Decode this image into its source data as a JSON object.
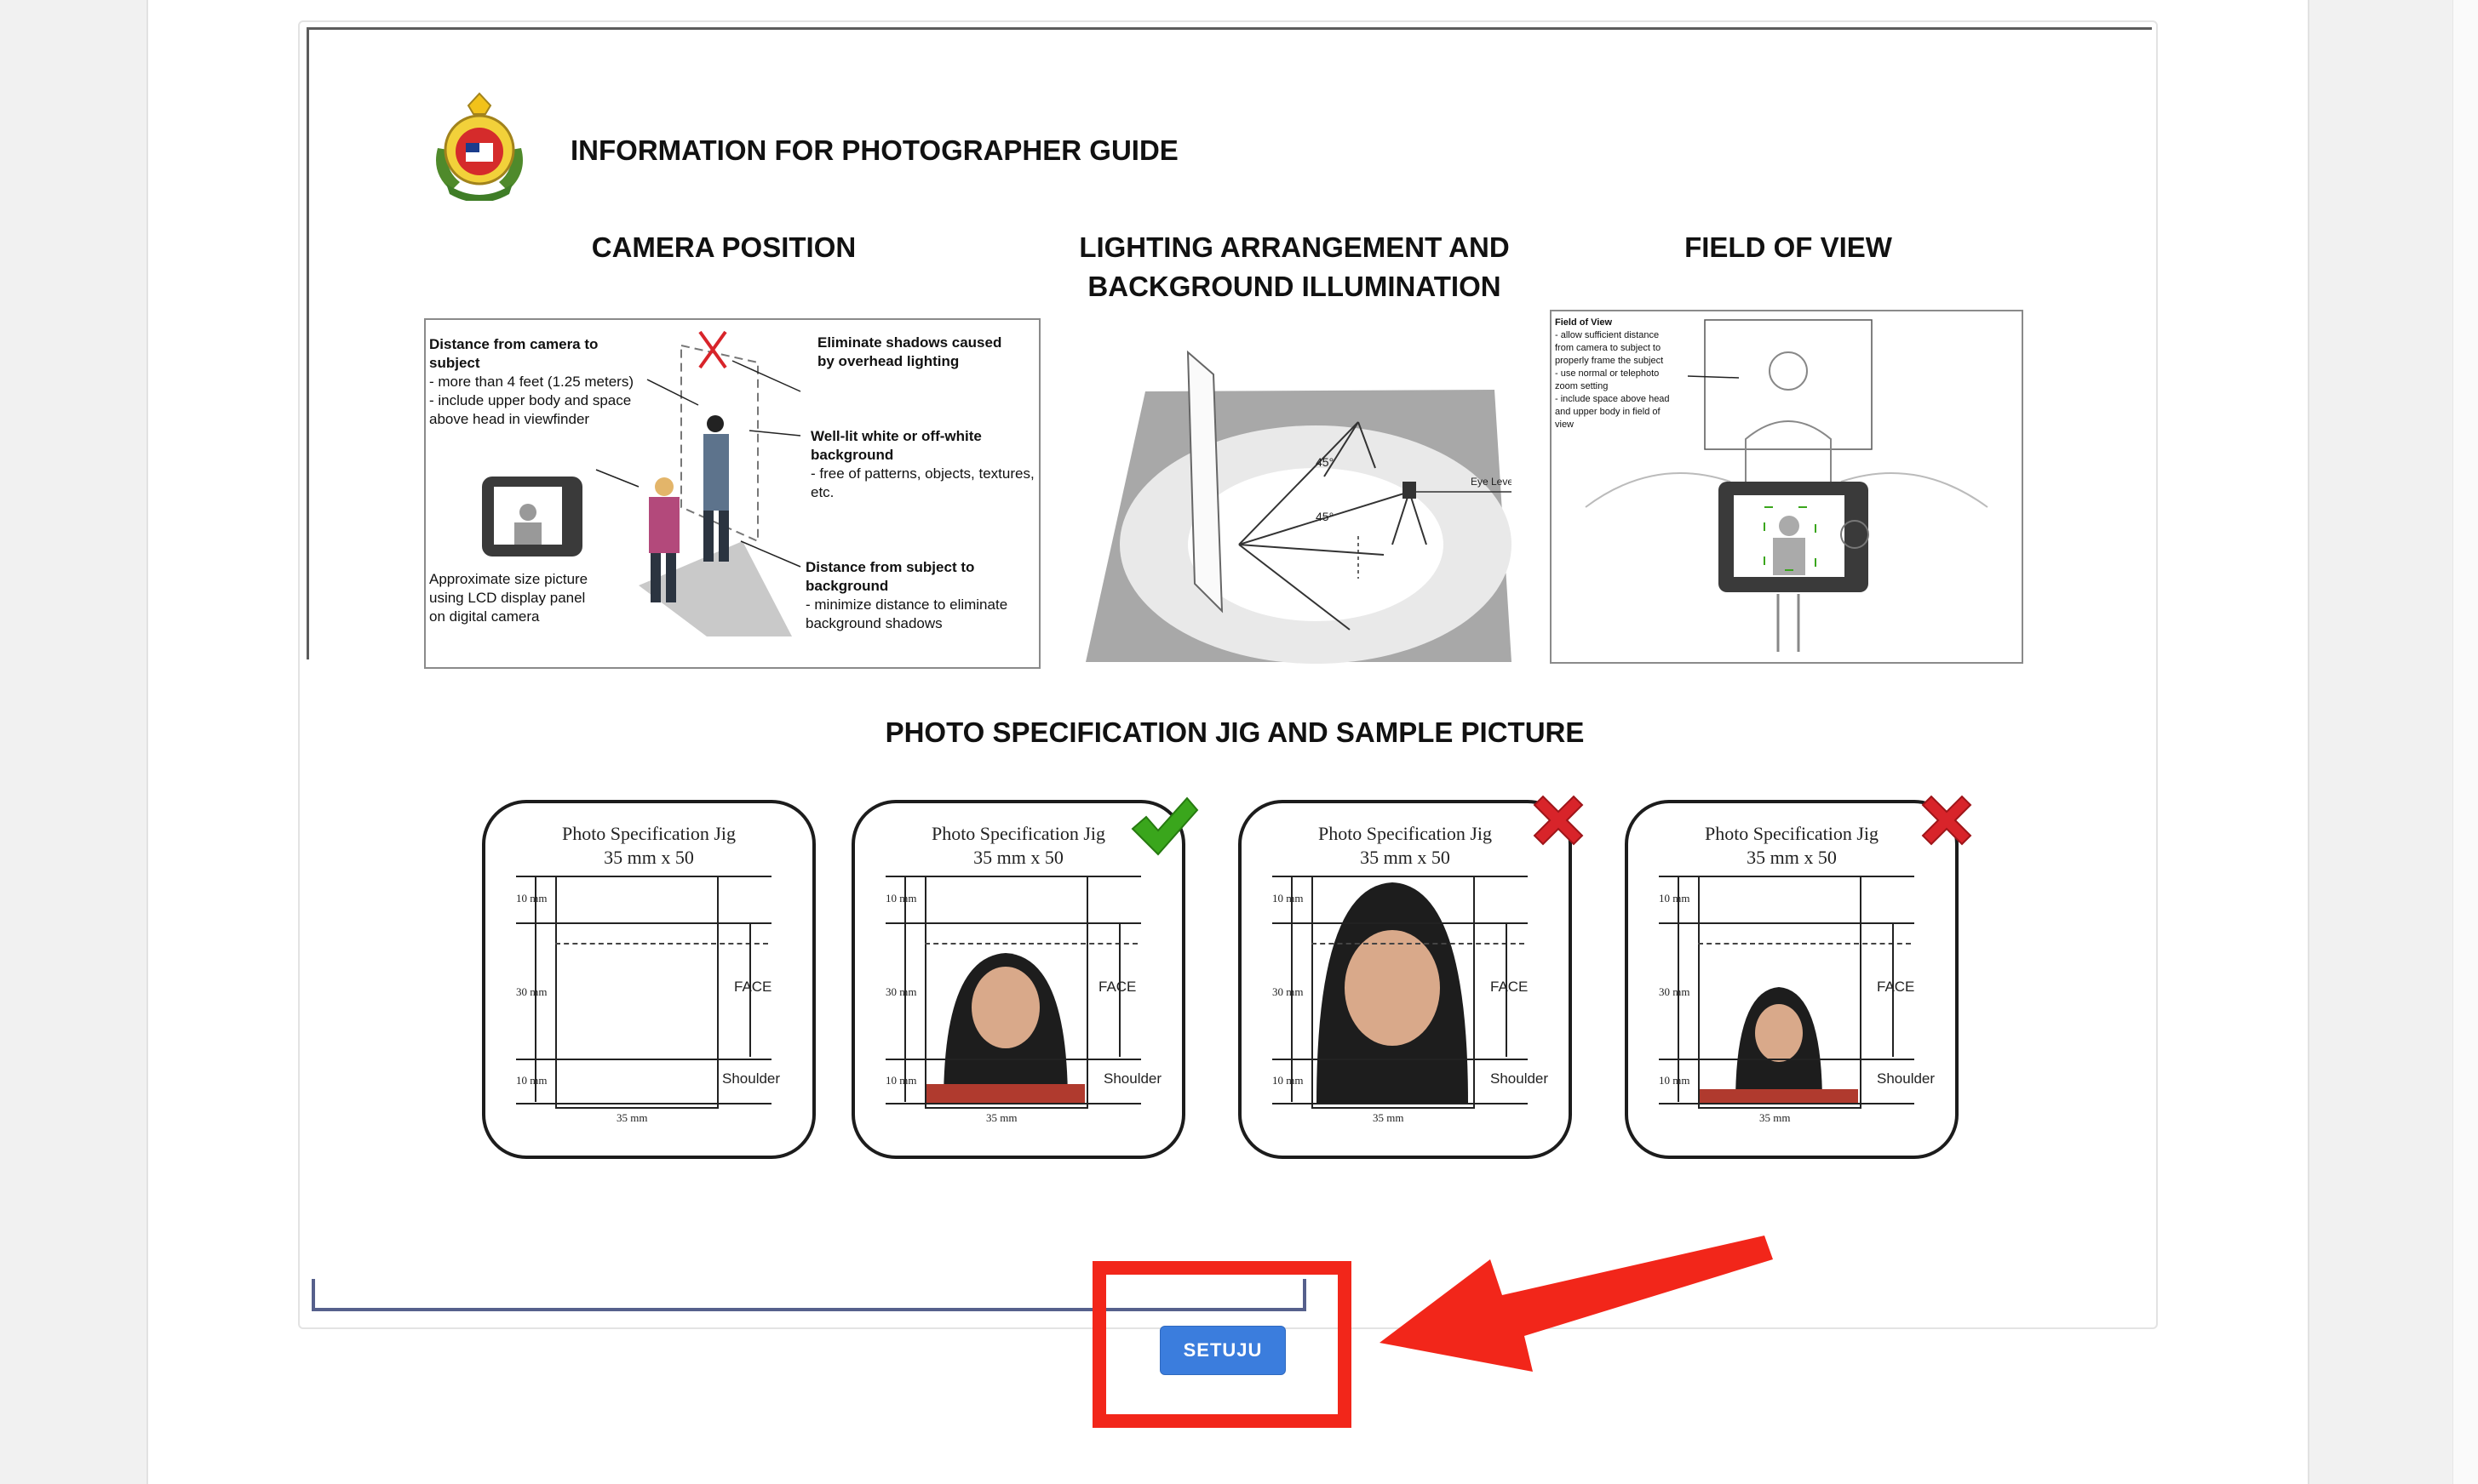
{
  "guide": {
    "title": "INFORMATION FOR PHOTOGRAPHER GUIDE",
    "sections": {
      "camera": "CAMERA POSITION",
      "lighting_line1": "LIGHTING ARRANGEMENT AND",
      "lighting_line2": "BACKGROUND ILLUMINATION",
      "fov": "FIELD OF VIEW",
      "jig": "PHOTO SPECIFICATION JIG AND SAMPLE PICTURE"
    },
    "camera_notes": {
      "distance_title": "Distance from camera to subject",
      "distance_lines": [
        "- more than 4 feet (1.25 meters)",
        "- include upper body and space",
        "above head in viewfinder"
      ],
      "shadow_title": "Eliminate shadows caused by overhead lighting",
      "bg_title": "Well-lit white or off-white background",
      "bg_lines": [
        "- free of patterns, objects, textures,",
        "etc."
      ],
      "lcd_lines": [
        "Approximate size picture",
        "using LCD display panel",
        "on digital camera"
      ],
      "dist_bg_title": "Distance from subject to background",
      "dist_bg_lines": [
        "- minimize distance to eliminate",
        "background shadows"
      ]
    },
    "lighting_notes": {
      "angle1": "45°",
      "angle2": "45°",
      "eye_level": "Eye Level"
    },
    "fov_notes": {
      "title": "Field of View",
      "lines": [
        "- allow sufficient distance",
        "from camera to subject to",
        "properly frame the subject",
        "- use normal or telephoto",
        "zoom setting",
        "- include space above head",
        "and upper body in field of",
        "view"
      ]
    },
    "jig": {
      "title_line1": "Photo Specification Jig",
      "title_line2": "35 mm x 50",
      "label_10mm": "10 mm",
      "label_30mm": "30 mm",
      "label_35mm": "35 mm",
      "face": "FACE",
      "shoulder": "Shoulder"
    }
  },
  "actions": {
    "agree_label": "SETUJU"
  },
  "colors": {
    "accent": "#3b7ddd",
    "annotation_red": "#f2261a",
    "check_green": "#3aa61c",
    "cross_red": "#d8242a"
  }
}
